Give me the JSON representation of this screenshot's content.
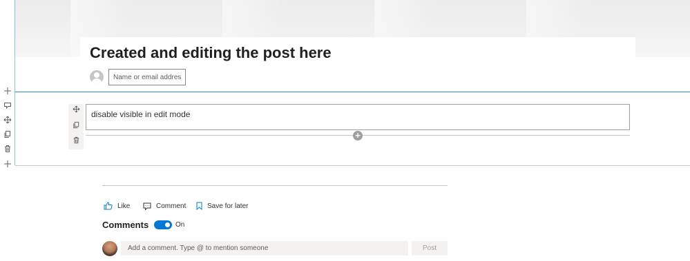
{
  "page": {
    "title": "Created and editing the post here",
    "author_placeholder": "Name or email address"
  },
  "text_webpart": {
    "content": "disable visible in edit mode"
  },
  "left_toolbar": {
    "icons": [
      "add-icon",
      "edit-section-icon",
      "move-icon",
      "duplicate-icon",
      "delete-icon",
      "add-icon"
    ]
  },
  "webpart_toolbar": {
    "icons": [
      "move-icon",
      "duplicate-icon",
      "delete-icon"
    ]
  },
  "social": {
    "like_label": "Like",
    "comment_label": "Comment",
    "save_label": "Save for later"
  },
  "comments": {
    "title": "Comments",
    "toggle_state": "On",
    "input_placeholder": "Add a comment. Type @ to mention someone",
    "post_label": "Post"
  },
  "colors": {
    "accent": "#0078d4",
    "section_border": "#2b88d8"
  }
}
